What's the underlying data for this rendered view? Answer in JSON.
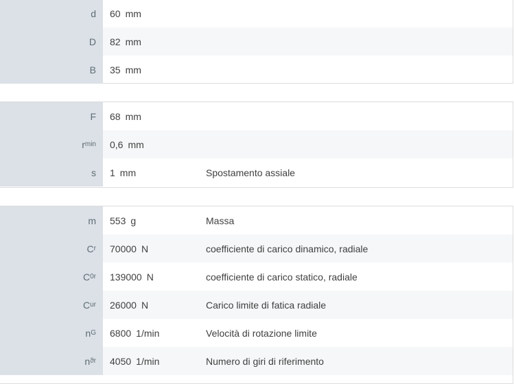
{
  "sections": [
    {
      "rows": [
        {
          "sym": "d",
          "sub": "",
          "value": "60",
          "unit": "mm",
          "desc": ""
        },
        {
          "sym": "D",
          "sub": "",
          "value": "82",
          "unit": "mm",
          "desc": ""
        },
        {
          "sym": "B",
          "sub": "",
          "value": "35",
          "unit": "mm",
          "desc": ""
        }
      ]
    },
    {
      "rows": [
        {
          "sym": "F",
          "sub": "",
          "value": "68",
          "unit": "mm",
          "desc": ""
        },
        {
          "sym": "r",
          "sub": "min",
          "value": "0,6",
          "unit": "mm",
          "desc": ""
        },
        {
          "sym": "s",
          "sub": "",
          "value": "1",
          "unit": "mm",
          "desc": "Spostamento assiale"
        }
      ]
    },
    {
      "rows": [
        {
          "sym": "m",
          "sub": "",
          "value": "553",
          "unit": "g",
          "desc": "Massa"
        },
        {
          "sym": "C",
          "sub": "r",
          "value": "70000",
          "unit": "N",
          "desc": "coefficiente di carico dinamico, radiale"
        },
        {
          "sym": "C",
          "sub": "0r",
          "value": "139000",
          "unit": "N",
          "desc": "coefficiente di carico statico, radiale"
        },
        {
          "sym": "C",
          "sub": "ur",
          "value": "26000",
          "unit": "N",
          "desc": "Carico limite di fatica radiale"
        },
        {
          "sym": "n",
          "sub": "G",
          "value": "6800",
          "unit": "1/min",
          "desc": "Velocità di rotazione limite"
        },
        {
          "sym": "n",
          "sub": "ϑr",
          "value": "4050",
          "unit": "1/min",
          "desc": "Numero di giri di riferimento"
        }
      ]
    }
  ]
}
